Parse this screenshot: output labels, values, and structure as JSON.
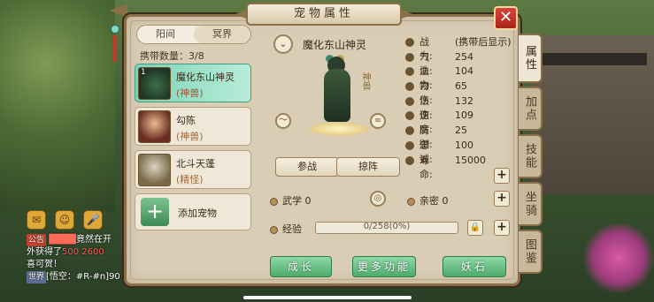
{
  "title": "宠物属性",
  "close_icon": "close-icon",
  "tabs": [
    "阳间",
    "冥界"
  ],
  "carry_count": "携带数量：3/8",
  "pets": [
    {
      "level": "1",
      "name": "魔化东山神灵",
      "type": "(神兽)"
    },
    {
      "level": "",
      "name": "勾陈",
      "type": "(神兽)"
    },
    {
      "level": "",
      "name": "北斗天蓬",
      "type": "(精怪)"
    }
  ],
  "add_pet": "添加宠物",
  "selected_pet": {
    "name": "魔化东山神灵",
    "badge": "神兽",
    "buttons": {
      "battle": "参战",
      "formation": "掠阵"
    },
    "wuxue": "武学 0",
    "qinmi": "亲密 0",
    "exp_label": "经验",
    "exp_text": "0/258(0%)",
    "exp_progress": 0
  },
  "stats": [
    {
      "label": "战力:",
      "value": "(携带后显示)"
    },
    {
      "label": "气血:",
      "value": "254"
    },
    {
      "label": "法力:",
      "value": "104"
    },
    {
      "label": "物伤:",
      "value": "65"
    },
    {
      "label": "法伤:",
      "value": "132"
    },
    {
      "label": "速度:",
      "value": "109"
    },
    {
      "label": "防御:",
      "value": "25"
    },
    {
      "label": "忠诚:",
      "value": "100"
    },
    {
      "label": "寿命:",
      "value": "15000"
    }
  ],
  "side_tabs": [
    "属性",
    "加点",
    "技能",
    "坐骑",
    "图鉴"
  ],
  "actions": [
    "成长",
    "更多功能",
    "妖石"
  ],
  "chat": {
    "line1_tag": "公告",
    "line1_text": "竟然在开",
    "line2_text": "外获得了",
    "line2_red": "500 2600",
    "line3_text": "喜可贺！",
    "line4_tag": "世界",
    "line4_text": "[悟空：#R-#n]90"
  }
}
